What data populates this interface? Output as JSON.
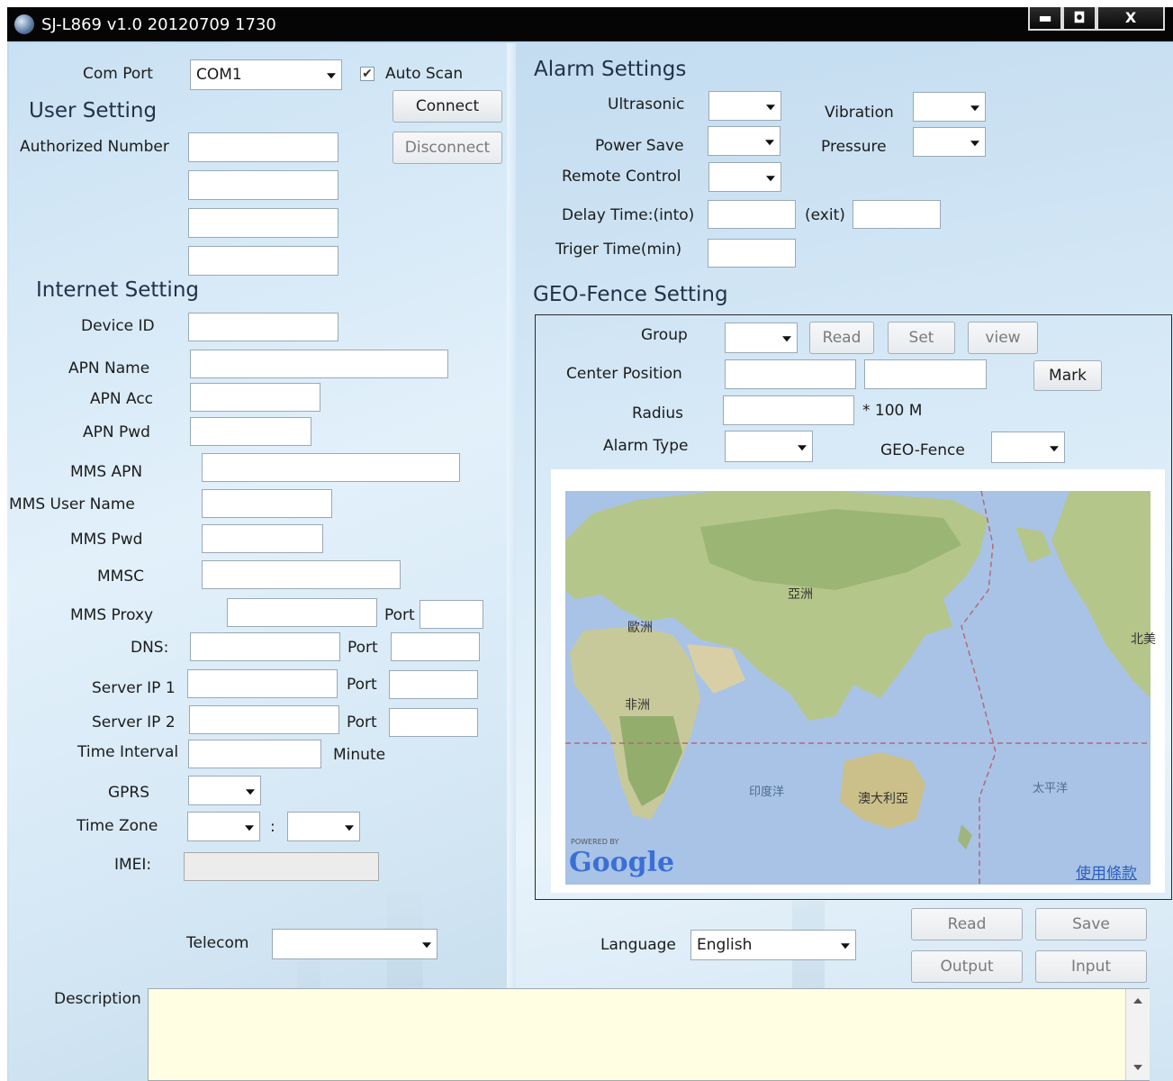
{
  "window": {
    "title": "SJ-L869 v1.0 20120709 1730",
    "minimize": "▬",
    "maximize": "◘",
    "close": "X"
  },
  "com": {
    "label": "Com Port",
    "value": "COM1",
    "auto_scan_label": "Auto Scan",
    "auto_scan_checked": true,
    "connect": "Connect",
    "disconnect": "Disconnect"
  },
  "user_setting": {
    "heading": "User Setting",
    "authorized_number_label": "Authorized Number"
  },
  "internet": {
    "heading": "Internet Setting",
    "device_id": "Device ID",
    "apn_name": "APN Name",
    "apn_acc": "APN Acc",
    "apn_pwd": "APN Pwd",
    "mms_apn": "MMS APN",
    "mms_user_name": "MMS User Name",
    "mms_pwd": "MMS Pwd",
    "mmsc": "MMSC",
    "mms_proxy": "MMS Proxy",
    "port": "Port",
    "dns": "DNS:",
    "server_ip_1": "Server IP 1",
    "server_ip_2": "Server IP 2",
    "time_interval": "Time Interval",
    "minute": "Minute",
    "gprs": "GPRS",
    "time_zone": "Time Zone",
    "tz_sep": ":",
    "imei": "IMEI:",
    "telecom": "Telecom",
    "description": "Description"
  },
  "alarm": {
    "heading": "Alarm Settings",
    "ultrasonic": "Ultrasonic",
    "vibration": "Vibration",
    "power_save": "Power Save",
    "pressure": "Pressure",
    "remote_control": "Remote Control",
    "delay_time": "Delay Time:(into)",
    "exit": "(exit)",
    "triger_time": "Triger Time(min)"
  },
  "geo": {
    "heading": "GEO-Fence Setting",
    "group": "Group",
    "read": "Read",
    "set": "Set",
    "view": "view",
    "center_position": "Center Position",
    "mark": "Mark",
    "radius": "Radius",
    "radius_unit": "* 100 M",
    "alarm_type": "Alarm Type",
    "geo_fence": "GEO-Fence"
  },
  "map": {
    "asia": "亞洲",
    "europe": "歐洲",
    "africa": "非洲",
    "indian_ocean": "印度洋",
    "australia": "澳大利亞",
    "pacific": "太平洋",
    "north_america": "北美",
    "powered_by": "POWERED BY",
    "google": "Google",
    "terms": "使用條款"
  },
  "bottom": {
    "language_label": "Language",
    "language_value": "English",
    "read": "Read",
    "save": "Save",
    "output": "Output",
    "input": "Input"
  },
  "colors": {
    "titlebar": "#050505",
    "panel_blue": "#d6e9f7",
    "description_bg": "#fffee2",
    "ocean": "#a9c3e6",
    "land": "#b9c98f"
  }
}
